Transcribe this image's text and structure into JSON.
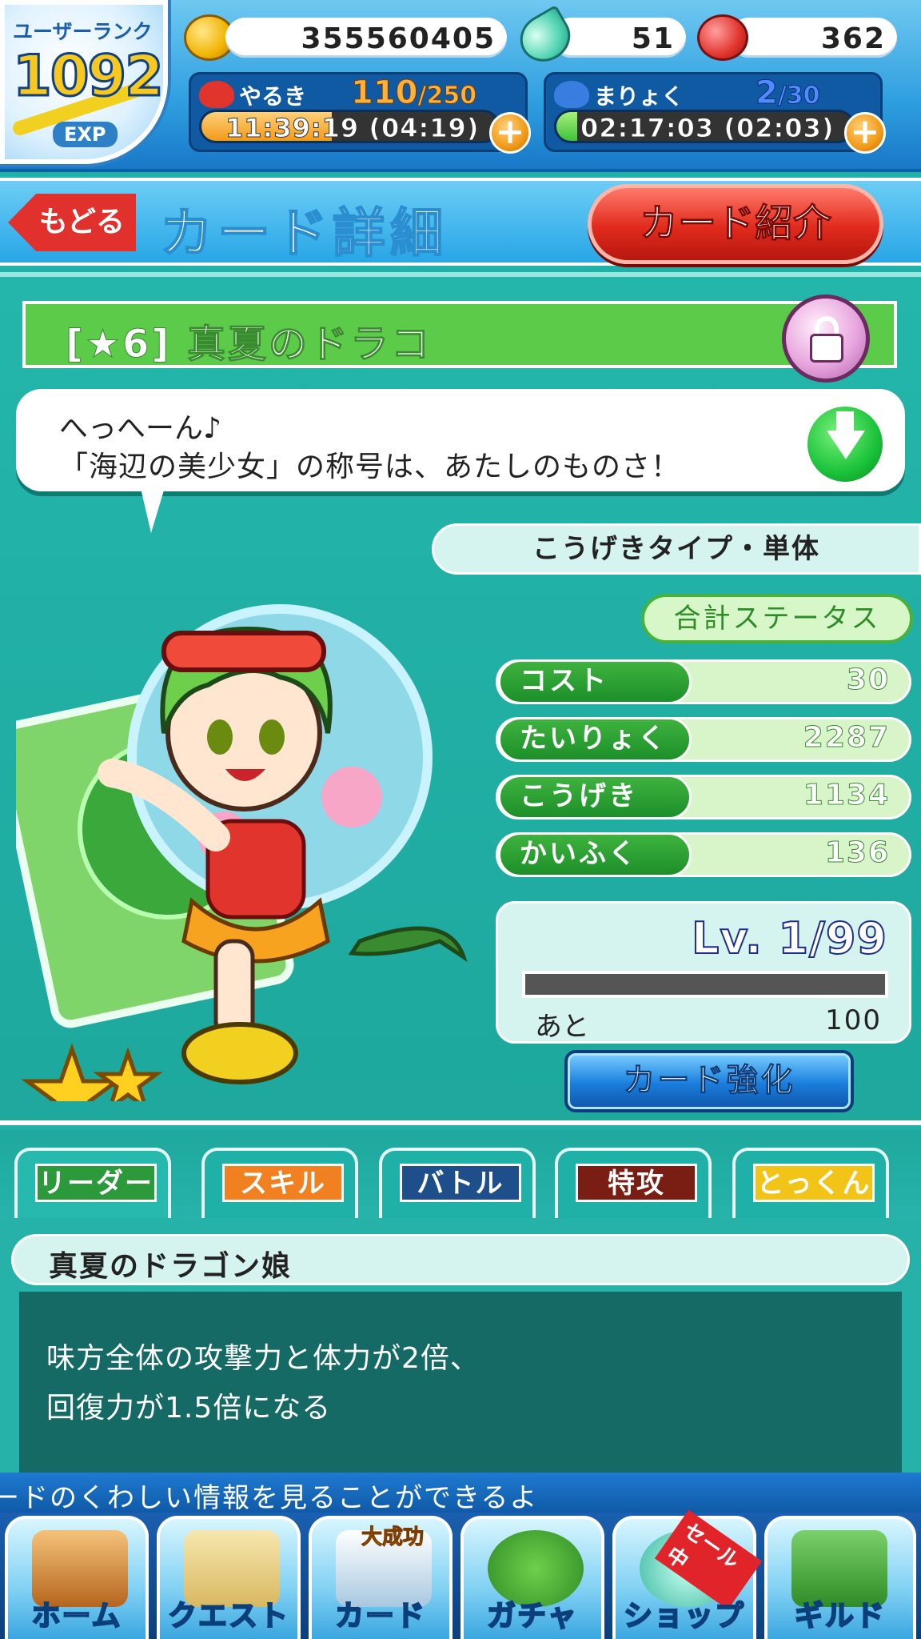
{
  "status": {
    "rank_label": "ユーザーランク",
    "rank_value": "1092",
    "exp_label": "EXP",
    "coins": "355560405",
    "gems": "51",
    "meat": "362",
    "yaruki": {
      "label": "やるき",
      "current": "110",
      "max": "/250",
      "timer": "11:39:19 (04:19)",
      "fill_fraction": 0.44
    },
    "maryoku": {
      "label": "まりょく",
      "current": "2",
      "max": "/30",
      "timer": "02:17:03 (02:03)",
      "fill_fraction": 0.07
    },
    "plus_symbol": "+"
  },
  "header": {
    "back_label": "もどる",
    "title": "カード詳細",
    "intro_button": "カード紹介"
  },
  "card": {
    "title": "[★6]  真夏のドラコ",
    "speech_line1": "へっへーん♪",
    "speech_line2": "「海辺の美少女」の称号は、あたしのものさ！",
    "attack_type": "こうげきタイプ・単体",
    "total_status_label": "合計ステータス",
    "stats": [
      {
        "label": "コスト",
        "value": "30"
      },
      {
        "label": "たいりょく",
        "value": "2287"
      },
      {
        "label": "こうげき",
        "value": "1134"
      },
      {
        "label": "かいふく",
        "value": "136"
      }
    ],
    "level": "Lv. 1/99",
    "level_fill_fraction": 0.0,
    "next_label": "あと",
    "next_value": "100",
    "enhance_button": "カード強化",
    "stars_shown": 2
  },
  "tabs": [
    {
      "label": "リーダー",
      "color": "#2c9a3a",
      "active": true
    },
    {
      "label": "スキル",
      "color": "#f08020",
      "active": false
    },
    {
      "label": "バトル",
      "color": "#1f4f8a",
      "active": false
    },
    {
      "label": "特攻",
      "color": "#7a1e14",
      "active": false
    },
    {
      "label": "とっくん",
      "color": "#f2c418",
      "active": false
    }
  ],
  "detail": {
    "title": "真夏のドラゴン娘",
    "line1": "味方全体の攻撃力と体力が2倍、",
    "line2": "回復力が1.5倍になる"
  },
  "ticker": "ードのくわしい情報を見ることができるよ",
  "nav": [
    {
      "label": "ホーム",
      "icon": "house-icon"
    },
    {
      "label": "クエスト",
      "icon": "map-icon"
    },
    {
      "label": "カード",
      "icon": "card-icon",
      "badge": "大成功"
    },
    {
      "label": "ガチャ",
      "icon": "puyo-icon"
    },
    {
      "label": "ショップ",
      "icon": "gem-icon",
      "badge": "セール中"
    },
    {
      "label": "ギルド",
      "icon": "guild-icon"
    }
  ]
}
